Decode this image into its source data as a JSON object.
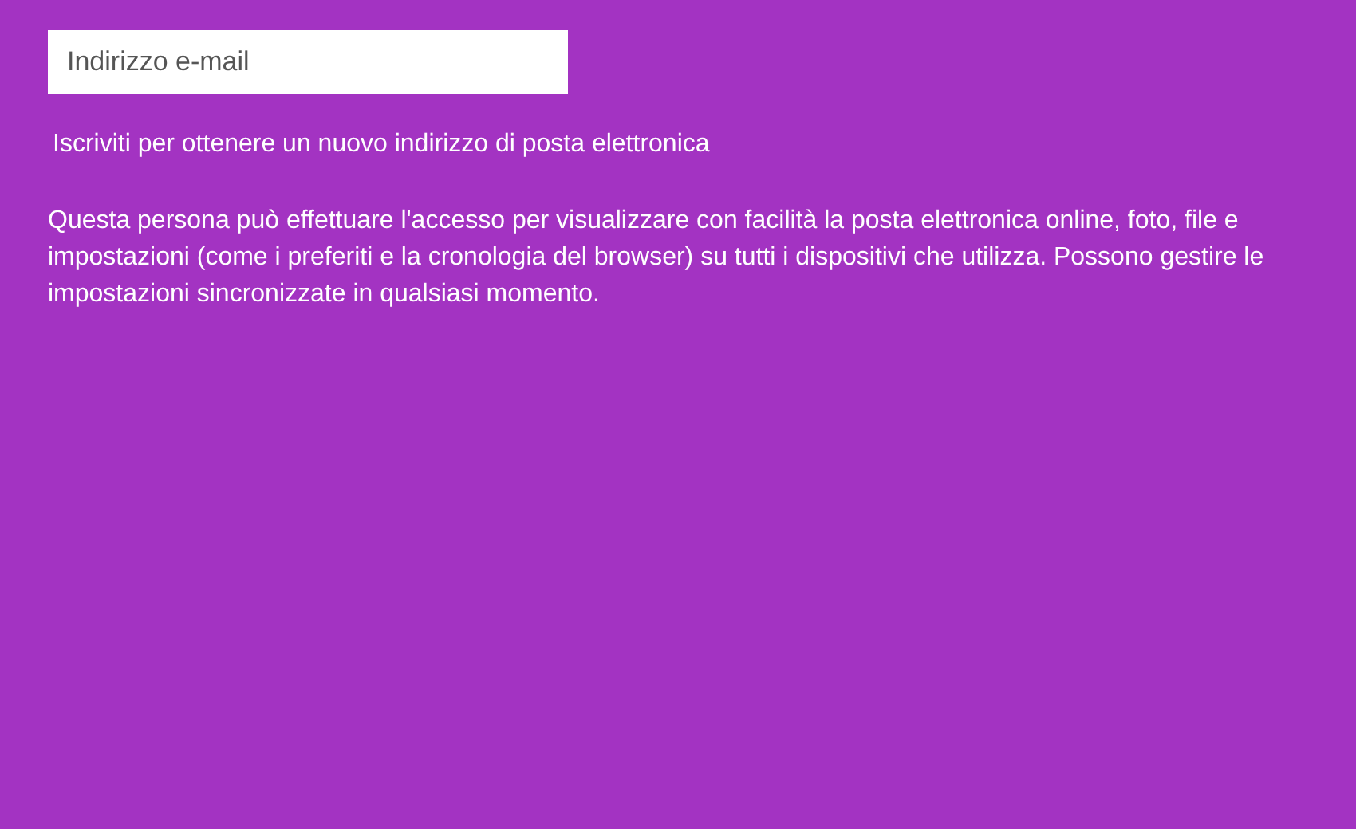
{
  "email_field": {
    "placeholder": "Indirizzo e-mail"
  },
  "signup_link": "Iscriviti per ottenere un nuovo indirizzo di posta elettronica",
  "description": "Questa persona può effettuare l'accesso per visualizzare con facilità la posta elettronica online, foto, file e impostazioni (come i preferiti e la cronologia del browser) su tutti i dispositivi che utilizza. Possono gestire le impostazioni sincronizzate in qualsiasi momento."
}
